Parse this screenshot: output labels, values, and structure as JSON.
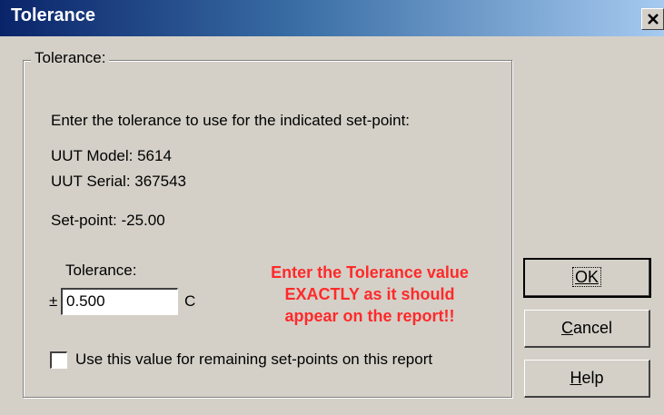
{
  "window": {
    "title": "Tolerance"
  },
  "group": {
    "label": "Tolerance:",
    "instruction": "Enter the tolerance to use for the indicated set-point:",
    "uut_model": "UUT Model: 5614",
    "uut_serial": "UUT Serial: 367543",
    "set_point": "Set-point: -25.00",
    "tolerance_label": "Tolerance:",
    "plus_minus": "±",
    "tolerance_value": "0.500",
    "unit": "C",
    "warning_line1": "Enter the Tolerance value",
    "warning_line2": "EXACTLY as it should",
    "warning_line3": "appear on the report!!",
    "checkbox_label": "Use this value for remaining set-points on this report",
    "checkbox_checked": false
  },
  "buttons": {
    "ok": "OK",
    "cancel_first": "C",
    "cancel_rest": "ancel",
    "help_first": "H",
    "help_rest": "elp"
  },
  "colors": {
    "warning": "#ff2a2a",
    "titlebar_start": "#0a246a",
    "titlebar_end": "#a6caf0",
    "face": "#d4d0c8"
  },
  "icons": {
    "close": "close-icon"
  }
}
